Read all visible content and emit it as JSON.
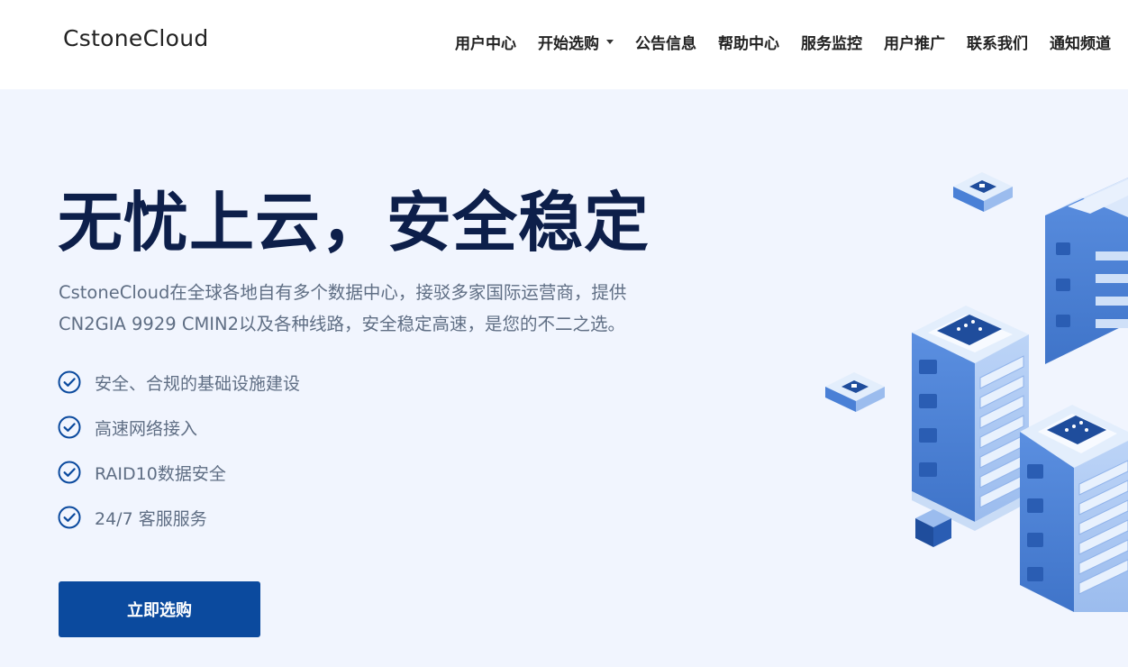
{
  "header": {
    "logo": "CstoneCloud",
    "nav": [
      {
        "label": "用户中心"
      },
      {
        "label": "开始选购"
      },
      {
        "label": "公告信息"
      },
      {
        "label": "帮助中心"
      },
      {
        "label": "服务监控"
      },
      {
        "label": "用户推广"
      },
      {
        "label": "联系我们"
      },
      {
        "label": "通知频道"
      }
    ]
  },
  "hero": {
    "title": "无忧上云，安全稳定",
    "description_line1": "CstoneCloud在全球各地自有多个数据中心，接驳多家国际运营商，提供",
    "description_line2": "CN2GIA 9929 CMIN2以及各种线路，安全稳定高速，是您的不二之选。",
    "features": [
      {
        "text": "安全、合规的基础设施建设",
        "icon": "check-circle-icon"
      },
      {
        "text": "高速网络接入",
        "icon": "check-circle-icon"
      },
      {
        "text": "RAID10数据安全",
        "icon": "check-circle-icon"
      },
      {
        "text": "24/7 客服服务",
        "icon": "check-circle-icon"
      }
    ],
    "cta_label": "立即选购"
  },
  "colors": {
    "primary": "#0b4a9e",
    "title": "#0d1f4a",
    "body_text": "#5f6e84",
    "hero_bg": "#f1f5fe"
  }
}
